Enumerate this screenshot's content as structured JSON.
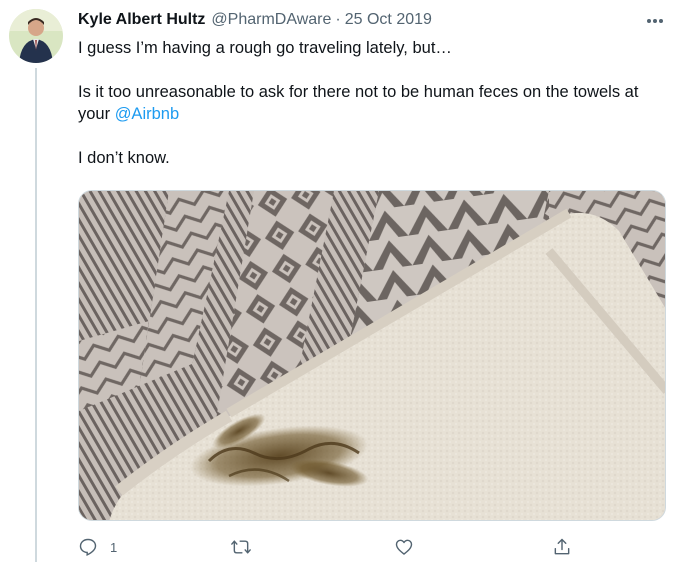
{
  "tweet": {
    "author": {
      "name": "Kyle Albert Hultz",
      "handle": "@PharmDAware",
      "separator": "·",
      "date": "25 Oct 2019"
    },
    "text": {
      "line1": "I guess I’m having a rough go traveling lately, but…",
      "line2_prefix": "Is it too unreasonable to ask for there not to be human feces on the towels at your ",
      "mention": "@Airbnb",
      "line3": "I don’t know."
    },
    "actions": {
      "reply_count": "1",
      "retweet_count": "",
      "like_count": ""
    },
    "icons": [
      "more-icon",
      "reply-icon",
      "retweet-icon",
      "like-icon",
      "share-icon"
    ],
    "colors": {
      "text": "#0f1419",
      "secondary": "#536471",
      "accent": "#1d9bf0",
      "thread_line": "#cfd9de"
    }
  }
}
